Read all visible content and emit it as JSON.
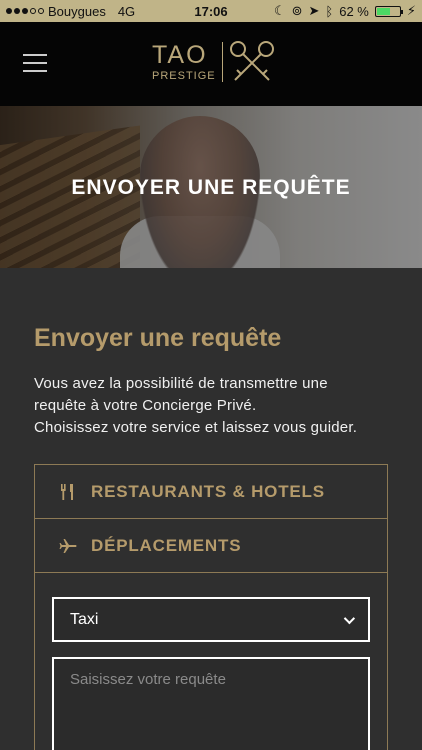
{
  "status": {
    "carrier": "Bouygues",
    "network": "4G",
    "time": "17:06",
    "battery": "62 %",
    "battery_level": 0.62
  },
  "header": {
    "logo_main": "TAO",
    "logo_sub": "PRESTIGE"
  },
  "hero": {
    "title": "ENVOYER UNE REQUÊTE"
  },
  "intro": {
    "title": "Envoyer une requête",
    "line1": "Vous avez la possibilité de transmettre une",
    "line2": "requête à votre Concierge Privé.",
    "line3": "Choisissez votre service et laissez vous guider."
  },
  "services": [
    {
      "label": "RESTAURANTS & HOTELS",
      "icon": "fork-knife-icon"
    },
    {
      "label": "DÉPLACEMENTS",
      "icon": "airplane-icon"
    }
  ],
  "form": {
    "select_value": "Taxi",
    "textarea_placeholder": "Saisissez votre requête"
  }
}
